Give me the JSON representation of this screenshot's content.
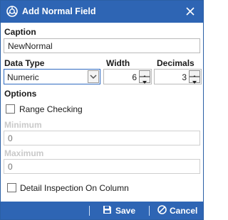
{
  "window": {
    "title": "Add Normal Field",
    "title_icon": "app-logo-icon",
    "close_icon": "close-icon"
  },
  "caption": {
    "label": "Caption",
    "value": "NewNormal"
  },
  "data_type": {
    "label": "Data Type",
    "selected": "Numeric"
  },
  "width": {
    "label": "Width",
    "value": "6"
  },
  "decimals": {
    "label": "Decimals",
    "value": "3"
  },
  "options": {
    "label": "Options",
    "range_checking_label": "Range Checking",
    "range_checking_checked": false
  },
  "minimum": {
    "label": "Minimum",
    "placeholder": "0"
  },
  "maximum": {
    "label": "Maximum",
    "placeholder": "0"
  },
  "detail_inspection": {
    "label": "Detail Inspection On Column",
    "checked": false
  },
  "buttons": {
    "save_label": "Save",
    "cancel_label": "Cancel"
  },
  "colors": {
    "titlebar": "#2e65b4",
    "focus_border": "#2f6ac0",
    "disabled_text": "#c9c9c9"
  }
}
